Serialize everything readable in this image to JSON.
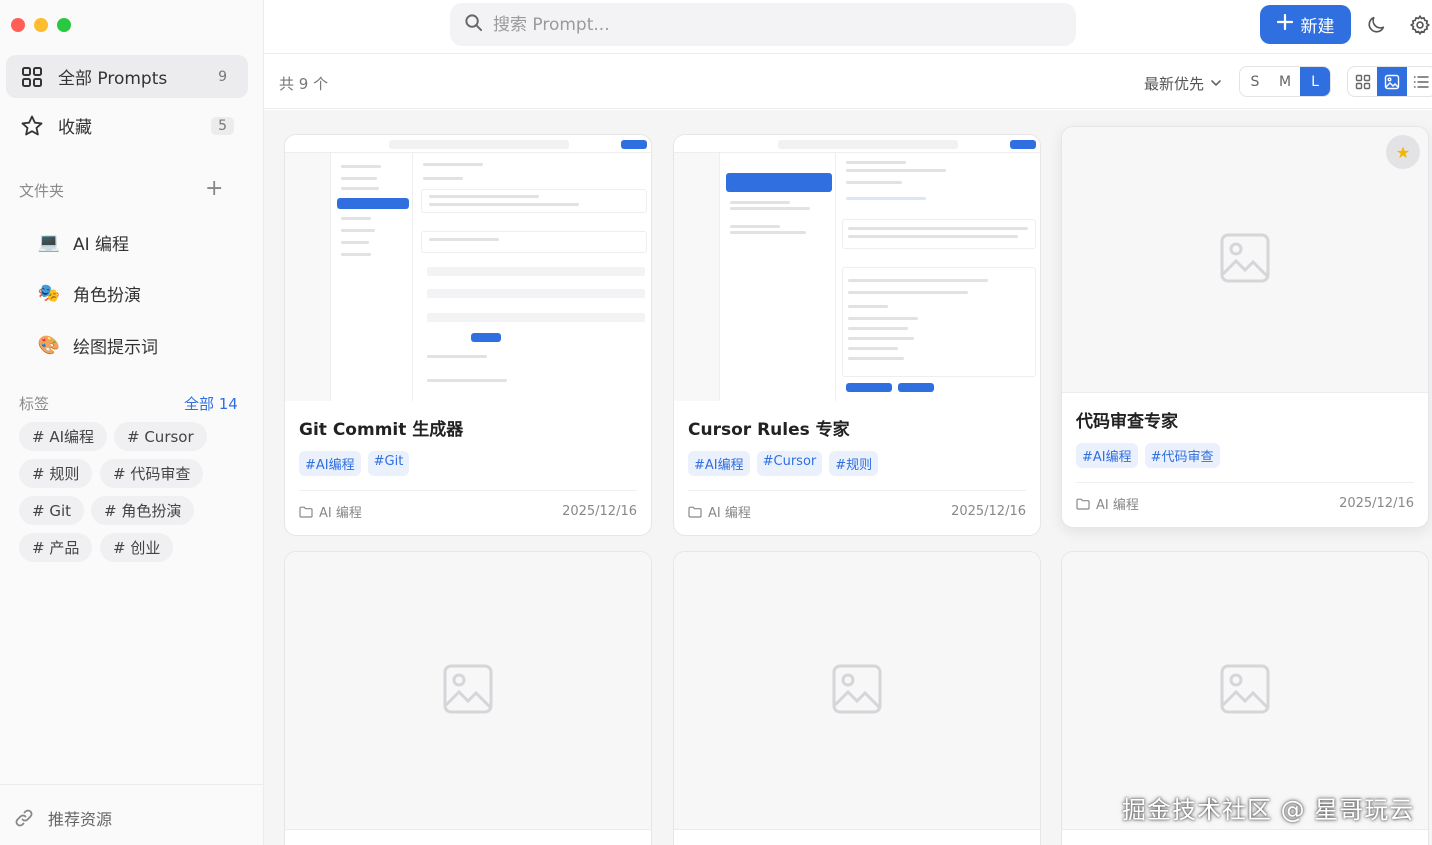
{
  "sidebar": {
    "nav": [
      {
        "label": "全部 Prompts",
        "count": "9",
        "icon": "grid-icon"
      },
      {
        "label": "收藏",
        "count": "5",
        "icon": "star-icon"
      }
    ],
    "folders_label": "文件夹",
    "folders_add": "+",
    "folders": [
      {
        "label": "AI 编程",
        "emoji": "💻"
      },
      {
        "label": "角色扮演",
        "emoji": "🎭"
      },
      {
        "label": "绘图提示词",
        "emoji": "🎨"
      }
    ],
    "tags_label": "标签",
    "tags_all": "全部 14",
    "tags": [
      "# AI编程",
      "# Cursor",
      "# 规则",
      "# 代码审查",
      "# Git",
      "# 角色扮演",
      "# 产品",
      "# 创业"
    ],
    "recommend": "推荐资源"
  },
  "header": {
    "search_placeholder": "搜索 Prompt...",
    "new_button": "新建"
  },
  "toolbar": {
    "total": "共 9 个",
    "sort": "最新优先",
    "sizes": [
      "S",
      "M",
      "L"
    ],
    "active_size": "L"
  },
  "cards": [
    {
      "title": "Git Commit 生成器",
      "tags": [
        "#AI编程",
        "#Git"
      ],
      "folder": "AI 编程",
      "date": "2025/12/16"
    },
    {
      "title": "Cursor Rules 专家",
      "tags": [
        "#AI编程",
        "#Cursor",
        "#规则"
      ],
      "folder": "AI 编程",
      "date": "2025/12/16"
    },
    {
      "title": "代码审查专家",
      "tags": [
        "#AI编程",
        "#代码审查"
      ],
      "folder": "AI 编程",
      "date": "2025/12/16",
      "favorite": true
    }
  ],
  "watermark": "掘金技术社区 @ 星哥玩云",
  "colors": {
    "accent": "#2f6fe0",
    "star": "#f5b400"
  }
}
